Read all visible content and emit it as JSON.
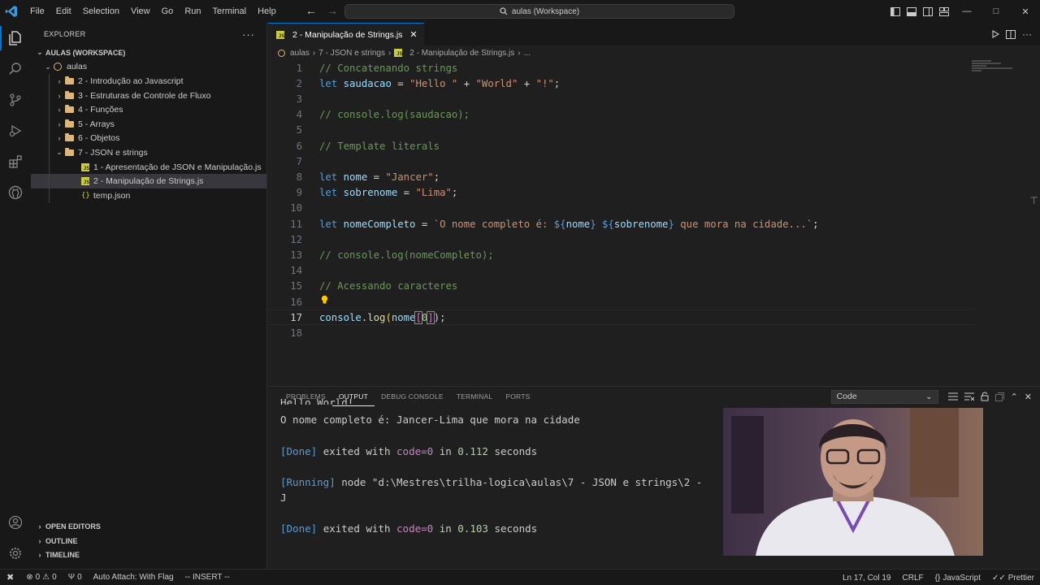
{
  "titlebar": {
    "menu": [
      "File",
      "Edit",
      "Selection",
      "View",
      "Go",
      "Run",
      "Terminal",
      "Help"
    ],
    "search": "aulas (Workspace)"
  },
  "sidebar": {
    "title": "EXPLORER",
    "workspace": "AULAS (WORKSPACE)",
    "root": "aulas",
    "folders": [
      "2 - Introdução ao Javascript",
      "3 - Estruturas de Controle de Fluxo",
      "4 - Funções",
      "5 - Arrays",
      "6 - Objetos",
      "7 - JSON e strings"
    ],
    "files": [
      "1 - Apresentação de JSON e Manipulação.js",
      "2 - Manipulação de Strings.js",
      "temp.json"
    ],
    "bottom_sections": [
      "OPEN EDITORS",
      "OUTLINE",
      "TIMELINE"
    ]
  },
  "editor": {
    "tab_label": "2 - Manipulação de Strings.js",
    "breadcrumbs": [
      "aulas",
      "7 - JSON e strings",
      "2 - Manipulação de Strings.js",
      "..."
    ],
    "line_numbers": [
      "1",
      "2",
      "3",
      "4",
      "5",
      "6",
      "7",
      "8",
      "9",
      "10",
      "11",
      "12",
      "13",
      "14",
      "15",
      "16",
      "17",
      "18"
    ],
    "code": {
      "l1": "// Concatenando strings",
      "l2_kw": "let",
      "l2_var": "saudacao",
      "l2_eq": "=",
      "l2_s1": "\"Hello \"",
      "l2_s2": "\"World\"",
      "l2_s3": "\"!\"",
      "l2_plus": "+",
      "l2_end": ";",
      "l4": "// console.log(saudacao);",
      "l6": "// Template literals",
      "l8_var": "nome",
      "l8_str": "\"Jancer\"",
      "l9_var": "sobrenome",
      "l9_str": "\"Lima\"",
      "l11_var": "nomeCompleto",
      "l11_t1": "`O nome completo é: ",
      "l11_open": "${",
      "l11_close": "}",
      "l11_v1": "nome",
      "l11_v2": "sobrenome",
      "l11_t2": " que mora na cidade...`",
      "l13": "// console.log(nomeCompleto);",
      "l15": "// Acessando caracteres",
      "l17_obj": "console",
      "l17_dot": ".",
      "l17_fn": "log",
      "l17_paren_open": "(",
      "l17_var": "nome",
      "l17_brk_open": "[",
      "l17_idx": "0",
      "l17_brk_close": "]",
      "l17_tail": ");"
    }
  },
  "panel": {
    "tabs": [
      "PROBLEMS",
      "OUTPUT",
      "DEBUG CONSOLE",
      "TERMINAL",
      "PORTS"
    ],
    "active_tab": "OUTPUT",
    "channel": "Code",
    "output": {
      "partial": "Hello World!",
      "line1": "O nome completo é: Jancer-Lima que mora na cidade",
      "done1_tag": "[Done]",
      "done1_text": "exited with",
      "done1_code": "code=0",
      "done1_in": "in",
      "done1_time": "0.112",
      "done1_unit": "seconds",
      "running_tag": "[Running]",
      "running_text": "node \"d:\\Mestres\\trilha-logica\\aulas\\7 - JSON e strings\\2 -",
      "output_char": "J",
      "done2_tag": "[Done]",
      "done2_text": "exited with",
      "done2_code": "code=0",
      "done2_in": "in",
      "done2_time": "0.103",
      "done2_unit": "seconds"
    }
  },
  "statusbar": {
    "errors": "0",
    "warnings": "0",
    "ports": "0",
    "auto_attach": "Auto Attach: With Flag",
    "mode": "-- INSERT --",
    "position": "Ln 17, Col 19",
    "eol": "CRLF",
    "language": "JavaScript",
    "formatter": "Prettier"
  },
  "colors": {
    "accent": "#0078d4",
    "keyword": "#569cd6",
    "string": "#ce9178",
    "comment": "#6a9955",
    "variable": "#9cdcfe"
  }
}
